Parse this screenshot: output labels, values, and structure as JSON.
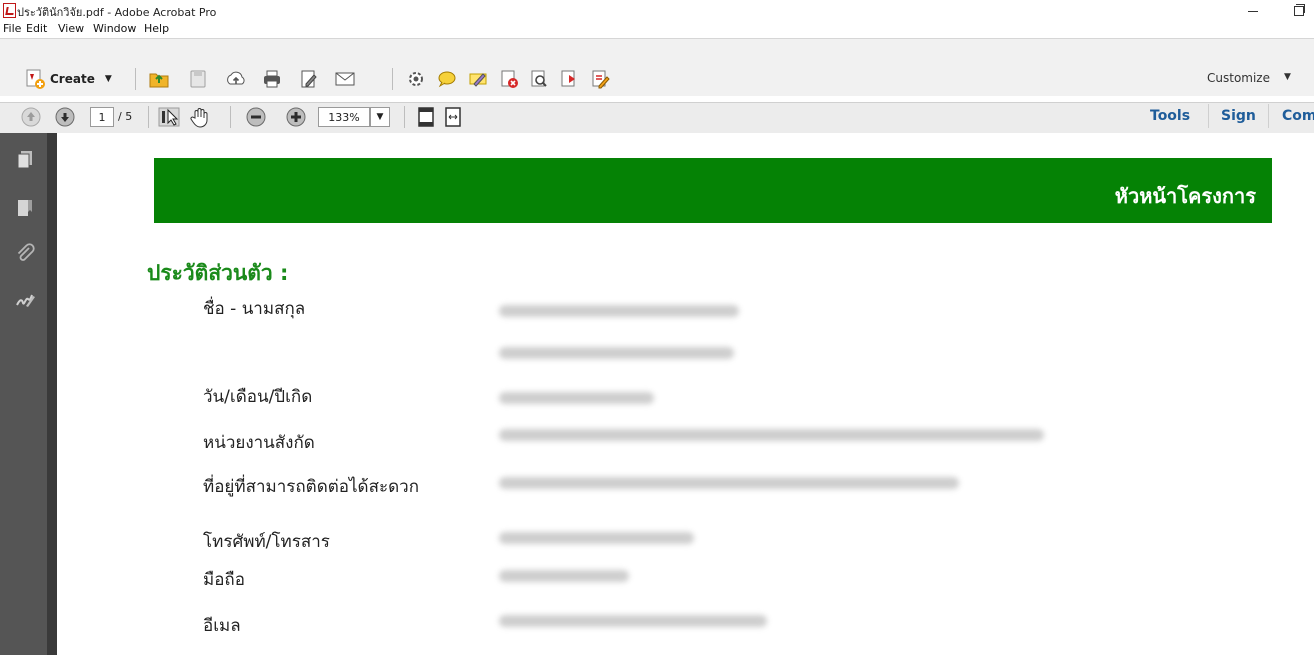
{
  "window": {
    "title": "ประวัตินักวิจัย.pdf - Adobe Acrobat Pro"
  },
  "menu": [
    "File",
    "Edit",
    "View",
    "Window",
    "Help"
  ],
  "toolbar": {
    "create_label": "Create",
    "customize_label": "Customize",
    "page_current": "1",
    "page_total": "/ 5",
    "zoom": "133%",
    "right_panes": [
      "Tools",
      "Sign",
      "Com"
    ]
  },
  "icons": {
    "toolbar": [
      "open-icon",
      "save-icon",
      "cloud-upload-icon",
      "print-icon",
      "edit-icon",
      "email-icon",
      "gear-icon",
      "comment-icon",
      "highlight-icon",
      "pdf-delete-icon",
      "pdf-search-icon",
      "pdf-export-icon",
      "pdf-edit-icon"
    ],
    "navigation": [
      "previous-page-icon",
      "next-page-icon",
      "select-tool-icon",
      "hand-tool-icon",
      "zoom-out-icon",
      "zoom-in-icon",
      "fit-page-icon",
      "fit-width-icon"
    ],
    "left_pane": [
      "pages-icon",
      "bookmarks-icon",
      "attachments-icon",
      "signatures-icon"
    ]
  },
  "document": {
    "header": "หัวหน้าโครงการ",
    "section": "ประวัติส่วนตัว :",
    "fields": [
      {
        "label": "ชื่อ - นามสกุล"
      },
      {
        "label": "วัน/เดือน/ปีเกิด"
      },
      {
        "label": "หน่วยงานสังกัด"
      },
      {
        "label": "ที่อยู่ที่สามารถติดต่อได้สะดวก"
      },
      {
        "label": "โทรศัพท์/โทรสาร"
      },
      {
        "label": "มือถือ"
      },
      {
        "label": "อีเมล"
      }
    ]
  }
}
